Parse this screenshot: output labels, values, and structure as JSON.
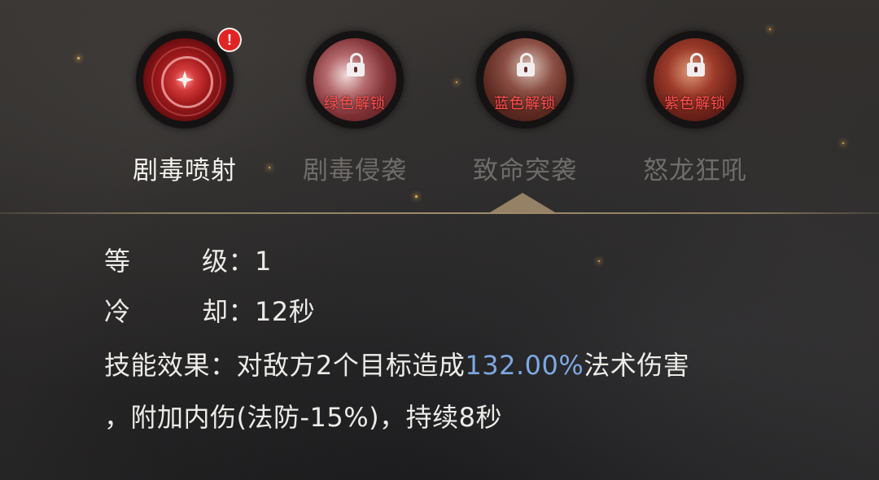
{
  "skills": [
    {
      "name": "剧毒喷射",
      "state": "selected",
      "icon": "skill-crimson-star-icon",
      "unlock_text": "",
      "badge": "!"
    },
    {
      "name": "剧毒侵袭",
      "state": "locked",
      "icon": "lock-icon",
      "unlock_text": "绿色解锁"
    },
    {
      "name": "致命突袭",
      "state": "locked",
      "icon": "lock-icon",
      "unlock_text": "蓝色解锁"
    },
    {
      "name": "怒龙狂吼",
      "state": "locked",
      "icon": "lock-icon",
      "unlock_text": "紫色解锁"
    }
  ],
  "details": {
    "level_label_1": "等",
    "level_label_2": "级：",
    "level_value": "1",
    "cooldown_label_1": "冷",
    "cooldown_label_2": "却：",
    "cooldown_value": "12秒",
    "effect_label": "技能效果：",
    "effect_text_pre": "对敌方2个目标造成",
    "effect_highlight": "132.00%",
    "effect_text_post": "法术伤害",
    "effect_line2": "，附加内伤(法防-15%)，持续8秒"
  },
  "colors": {
    "highlight": "#7ea8e2",
    "locked_text": "#ff4d4d",
    "badge": "#e02424",
    "divider": "#a08c6c"
  }
}
